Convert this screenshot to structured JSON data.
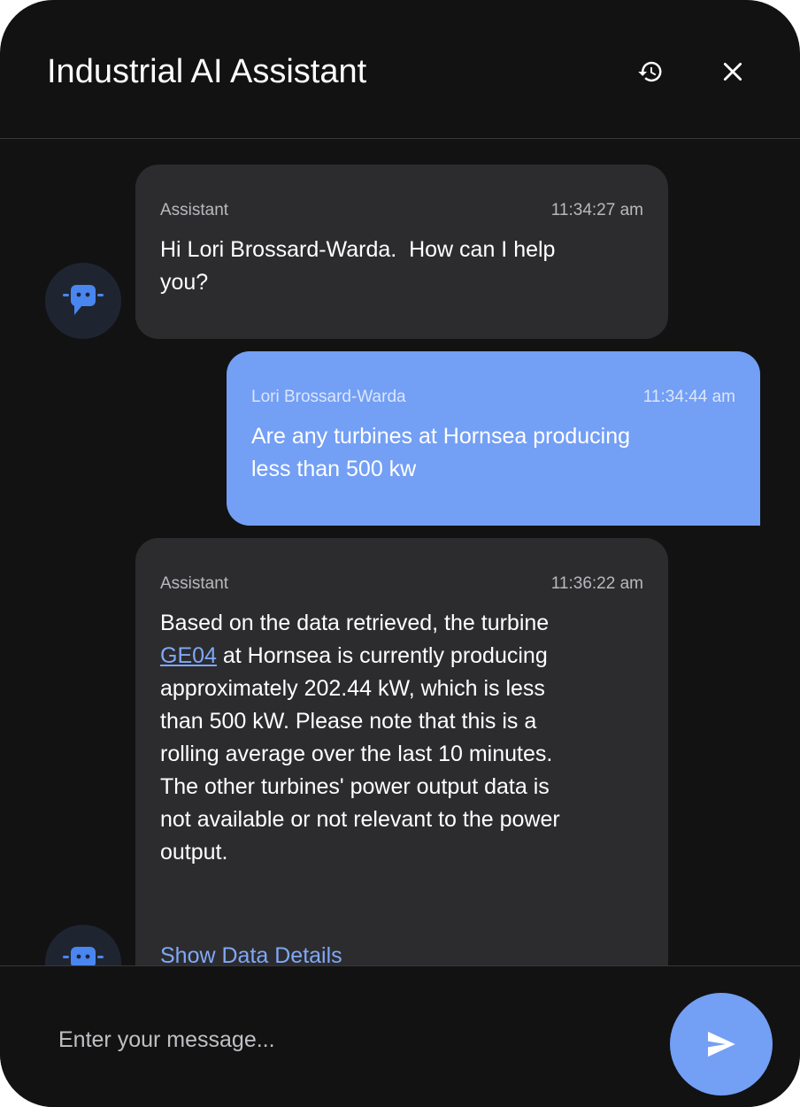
{
  "header": {
    "title": "Industrial AI Assistant",
    "history_icon": "history-icon",
    "close_icon": "close-icon"
  },
  "messages": [
    {
      "role": "assistant",
      "sender": "Assistant",
      "time": "11:34:27 am",
      "lines": [
        "Hi Lori Brossard-Warda.  How can I help",
        "you?"
      ]
    },
    {
      "role": "user",
      "sender": "Lori Brossard-Warda",
      "time": "11:34:44 am",
      "lines": [
        "Are any turbines at Hornsea producing",
        "less than 500 kw"
      ]
    },
    {
      "role": "assistant",
      "sender": "Assistant",
      "time": "11:36:22 am",
      "line1": "Based on the data retrieved, the turbine",
      "link_text": "GE04",
      "line2_rest": " at Hornsea is currently producing",
      "lines_after": [
        "approximately 202.44 kW, which is less",
        "than 500 kW. Please note that this is a",
        "rolling average over the last 10 minutes.",
        "The other turbines' power output data is",
        "not available or not relevant to the power",
        "output."
      ],
      "show_details": "Show Data Details"
    }
  ],
  "composer": {
    "placeholder": "Enter your message...",
    "send_icon": "send-icon"
  },
  "colors": {
    "background": "#121213",
    "assistant_bubble": "#2c2c2e",
    "user_bubble": "#739ff5",
    "accent": "#80a8f8"
  }
}
